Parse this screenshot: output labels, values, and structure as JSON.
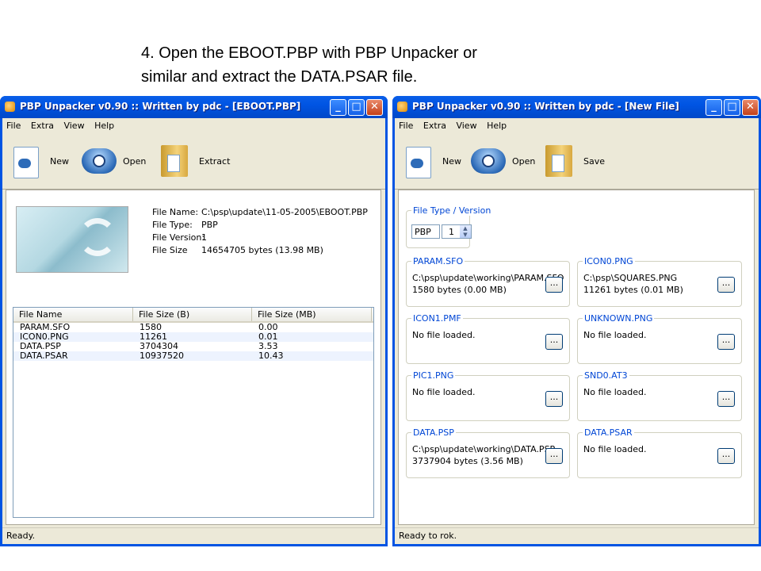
{
  "caption": {
    "line1": "4. Open the EBOOT.PBP with PBP Unpacker or",
    "line2": "similar and extract the DATA.PSAR file."
  },
  "left_window": {
    "title": "PBP Unpacker v0.90 :: Written by pdc - [EBOOT.PBP]",
    "menu": [
      "File",
      "Extra",
      "View",
      "Help"
    ],
    "toolbar": {
      "new": "New",
      "open": "Open",
      "extract": "Extract"
    },
    "file_info": {
      "name_label": "File Name:",
      "name_value": "C:\\psp\\update\\11-05-2005\\EBOOT.PBP",
      "type_label": "File Type:",
      "type_value": "PBP",
      "version_label": "File Version:",
      "version_value": "1",
      "size_label": "File Size",
      "size_value": "14654705 bytes (13.98 MB)"
    },
    "columns": [
      "File Name",
      "File Size (B)",
      "File Size (MB)"
    ],
    "rows": [
      [
        "PARAM.SFO",
        "1580",
        "0.00"
      ],
      [
        "ICON0.PNG",
        "11261",
        "0.01"
      ],
      [
        "DATA.PSP",
        "3704304",
        "3.53"
      ],
      [
        "DATA.PSAR",
        "10937520",
        "10.43"
      ]
    ],
    "status": "Ready."
  },
  "right_window": {
    "title": "PBP Unpacker v0.90 :: Written by pdc - [New File]",
    "menu": [
      "File",
      "Extra",
      "View",
      "Help"
    ],
    "toolbar": {
      "new": "New",
      "open": "Open",
      "save": "Save"
    },
    "type_group": {
      "title": "File Type / Version",
      "type": "PBP",
      "version": "1"
    },
    "browse_label": "...",
    "groups": [
      {
        "title": "PARAM.SFO",
        "line1": "C:\\psp\\update\\working\\PARAM.SFO",
        "line2": "1580 bytes (0.00 MB)"
      },
      {
        "title": "ICON0.PNG",
        "line1": "C:\\psp\\SQUARES.PNG",
        "line2": "11261 bytes (0.01 MB)"
      },
      {
        "title": "ICON1.PMF",
        "line1": "No file loaded.",
        "line2": ""
      },
      {
        "title": "UNKNOWN.PNG",
        "line1": "No file loaded.",
        "line2": ""
      },
      {
        "title": "PIC1.PNG",
        "line1": "No file loaded.",
        "line2": ""
      },
      {
        "title": "SND0.AT3",
        "line1": "No file loaded.",
        "line2": ""
      },
      {
        "title": "DATA.PSP",
        "line1": "C:\\psp\\update\\working\\DATA.PSP",
        "line2": "3737904 bytes (3.56 MB)"
      },
      {
        "title": "DATA.PSAR",
        "line1": "No file loaded.",
        "line2": ""
      }
    ],
    "status": "Ready to rok."
  }
}
